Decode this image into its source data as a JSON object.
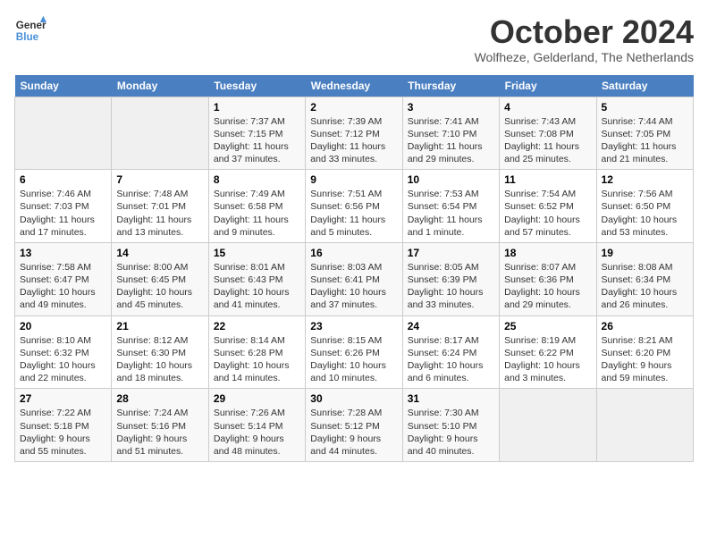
{
  "logo": {
    "line1": "General",
    "line2": "Blue"
  },
  "title": "October 2024",
  "subtitle": "Wolfheze, Gelderland, The Netherlands",
  "days_header": [
    "Sunday",
    "Monday",
    "Tuesday",
    "Wednesday",
    "Thursday",
    "Friday",
    "Saturday"
  ],
  "weeks": [
    [
      {
        "num": "",
        "info": ""
      },
      {
        "num": "",
        "info": ""
      },
      {
        "num": "1",
        "info": "Sunrise: 7:37 AM\nSunset: 7:15 PM\nDaylight: 11 hours and 37 minutes."
      },
      {
        "num": "2",
        "info": "Sunrise: 7:39 AM\nSunset: 7:12 PM\nDaylight: 11 hours and 33 minutes."
      },
      {
        "num": "3",
        "info": "Sunrise: 7:41 AM\nSunset: 7:10 PM\nDaylight: 11 hours and 29 minutes."
      },
      {
        "num": "4",
        "info": "Sunrise: 7:43 AM\nSunset: 7:08 PM\nDaylight: 11 hours and 25 minutes."
      },
      {
        "num": "5",
        "info": "Sunrise: 7:44 AM\nSunset: 7:05 PM\nDaylight: 11 hours and 21 minutes."
      }
    ],
    [
      {
        "num": "6",
        "info": "Sunrise: 7:46 AM\nSunset: 7:03 PM\nDaylight: 11 hours and 17 minutes."
      },
      {
        "num": "7",
        "info": "Sunrise: 7:48 AM\nSunset: 7:01 PM\nDaylight: 11 hours and 13 minutes."
      },
      {
        "num": "8",
        "info": "Sunrise: 7:49 AM\nSunset: 6:58 PM\nDaylight: 11 hours and 9 minutes."
      },
      {
        "num": "9",
        "info": "Sunrise: 7:51 AM\nSunset: 6:56 PM\nDaylight: 11 hours and 5 minutes."
      },
      {
        "num": "10",
        "info": "Sunrise: 7:53 AM\nSunset: 6:54 PM\nDaylight: 11 hours and 1 minute."
      },
      {
        "num": "11",
        "info": "Sunrise: 7:54 AM\nSunset: 6:52 PM\nDaylight: 10 hours and 57 minutes."
      },
      {
        "num": "12",
        "info": "Sunrise: 7:56 AM\nSunset: 6:50 PM\nDaylight: 10 hours and 53 minutes."
      }
    ],
    [
      {
        "num": "13",
        "info": "Sunrise: 7:58 AM\nSunset: 6:47 PM\nDaylight: 10 hours and 49 minutes."
      },
      {
        "num": "14",
        "info": "Sunrise: 8:00 AM\nSunset: 6:45 PM\nDaylight: 10 hours and 45 minutes."
      },
      {
        "num": "15",
        "info": "Sunrise: 8:01 AM\nSunset: 6:43 PM\nDaylight: 10 hours and 41 minutes."
      },
      {
        "num": "16",
        "info": "Sunrise: 8:03 AM\nSunset: 6:41 PM\nDaylight: 10 hours and 37 minutes."
      },
      {
        "num": "17",
        "info": "Sunrise: 8:05 AM\nSunset: 6:39 PM\nDaylight: 10 hours and 33 minutes."
      },
      {
        "num": "18",
        "info": "Sunrise: 8:07 AM\nSunset: 6:36 PM\nDaylight: 10 hours and 29 minutes."
      },
      {
        "num": "19",
        "info": "Sunrise: 8:08 AM\nSunset: 6:34 PM\nDaylight: 10 hours and 26 minutes."
      }
    ],
    [
      {
        "num": "20",
        "info": "Sunrise: 8:10 AM\nSunset: 6:32 PM\nDaylight: 10 hours and 22 minutes."
      },
      {
        "num": "21",
        "info": "Sunrise: 8:12 AM\nSunset: 6:30 PM\nDaylight: 10 hours and 18 minutes."
      },
      {
        "num": "22",
        "info": "Sunrise: 8:14 AM\nSunset: 6:28 PM\nDaylight: 10 hours and 14 minutes."
      },
      {
        "num": "23",
        "info": "Sunrise: 8:15 AM\nSunset: 6:26 PM\nDaylight: 10 hours and 10 minutes."
      },
      {
        "num": "24",
        "info": "Sunrise: 8:17 AM\nSunset: 6:24 PM\nDaylight: 10 hours and 6 minutes."
      },
      {
        "num": "25",
        "info": "Sunrise: 8:19 AM\nSunset: 6:22 PM\nDaylight: 10 hours and 3 minutes."
      },
      {
        "num": "26",
        "info": "Sunrise: 8:21 AM\nSunset: 6:20 PM\nDaylight: 9 hours and 59 minutes."
      }
    ],
    [
      {
        "num": "27",
        "info": "Sunrise: 7:22 AM\nSunset: 5:18 PM\nDaylight: 9 hours and 55 minutes."
      },
      {
        "num": "28",
        "info": "Sunrise: 7:24 AM\nSunset: 5:16 PM\nDaylight: 9 hours and 51 minutes."
      },
      {
        "num": "29",
        "info": "Sunrise: 7:26 AM\nSunset: 5:14 PM\nDaylight: 9 hours and 48 minutes."
      },
      {
        "num": "30",
        "info": "Sunrise: 7:28 AM\nSunset: 5:12 PM\nDaylight: 9 hours and 44 minutes."
      },
      {
        "num": "31",
        "info": "Sunrise: 7:30 AM\nSunset: 5:10 PM\nDaylight: 9 hours and 40 minutes."
      },
      {
        "num": "",
        "info": ""
      },
      {
        "num": "",
        "info": ""
      }
    ]
  ]
}
